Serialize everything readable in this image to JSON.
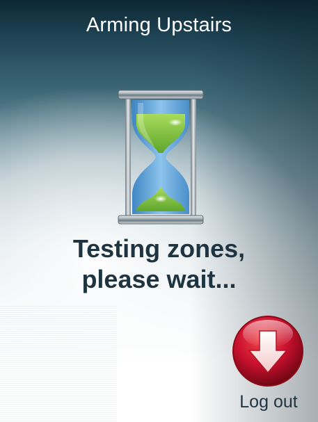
{
  "header": {
    "title": "Arming Upstairs"
  },
  "status": {
    "icon": "hourglass-icon",
    "message_line1": "Testing zones,",
    "message_line2": "please wait..."
  },
  "actions": {
    "logout_label": "Log out",
    "logout_icon": "arrow-down-icon"
  },
  "colors": {
    "header_background": "#1d4252",
    "title_text": "#ffffff",
    "message_text": "#1e3440",
    "sand_green": "#7cc242",
    "glass_blue": "#5b9fd4",
    "logout_red": "#c8102e"
  }
}
